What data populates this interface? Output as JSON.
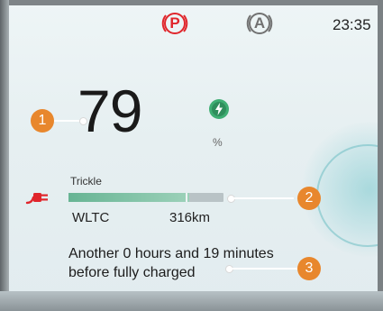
{
  "status_bar": {
    "park_brake_icon_letter": "P",
    "auto_hold_icon_letter": "A",
    "time": "23:35"
  },
  "battery": {
    "state_of_charge": "79",
    "unit": "%",
    "charging_indicator_icon": "lightning-bolt-icon"
  },
  "charging": {
    "plug_icon": "charging-plug-icon",
    "mode": "Trickle",
    "range_bar_fraction": 0.78,
    "range_standard": "WLTC",
    "range": "316km",
    "message": "Another 0 hours and 19 minutes before fully charged"
  },
  "callouts": [
    "1",
    "2",
    "3"
  ],
  "colors": {
    "park_red": "#e0252b",
    "callout_orange": "#e8872d",
    "bar_green": "#67b494",
    "bolt_green": "#3fae73"
  }
}
